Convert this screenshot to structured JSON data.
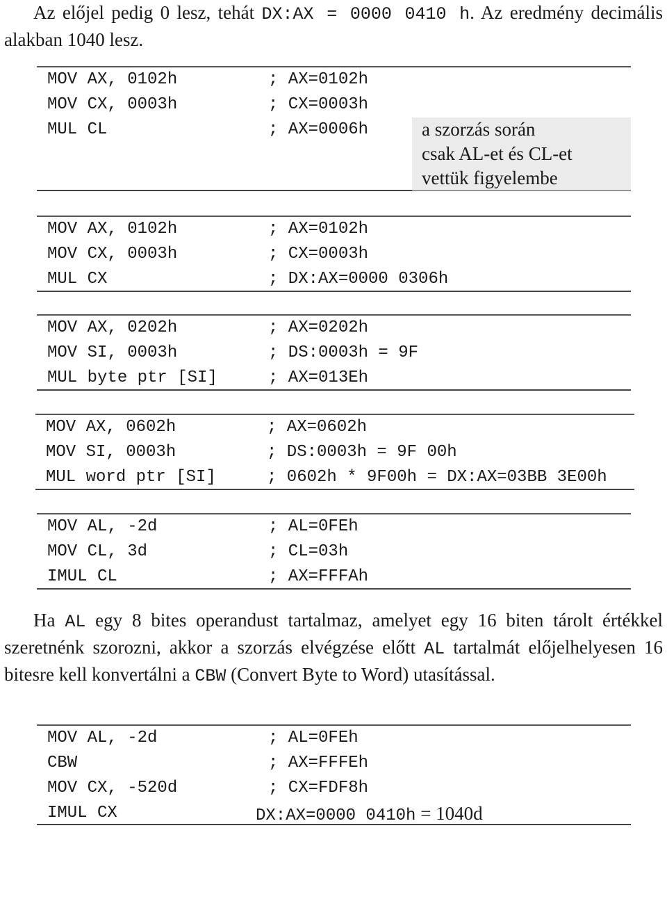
{
  "intro": {
    "text_before": "Az előjel pedig 0 lesz, tehát ",
    "code": "DX:AX = 0000 0410 h",
    "text_after": ".  Az eredmény decimális alakban 1040 lesz."
  },
  "blocks": [
    {
      "rows": [
        {
          "instr": "MOV AX, 0102h",
          "comment": "; AX=0102h"
        },
        {
          "instr": "MOV CX, 0003h",
          "comment": "; CX=0003h"
        },
        {
          "instr": "MUL CL",
          "comment": "; AX=0006h"
        }
      ],
      "note": [
        "a szorzás során",
        "csak AL-et és CL-et",
        "vettük figyelembe"
      ]
    },
    {
      "rows": [
        {
          "instr": "MOV AX, 0102h",
          "comment": "; AX=0102h"
        },
        {
          "instr": "MOV CX, 0003h",
          "comment": "; CX=0003h"
        },
        {
          "instr": "MUL CX",
          "comment": "; DX:AX=0000 0306h"
        }
      ]
    },
    {
      "rows": [
        {
          "instr": "MOV AX, 0202h",
          "comment": "; AX=0202h"
        },
        {
          "instr": "MOV SI, 0003h",
          "comment": "; DS:0003h = 9F"
        },
        {
          "instr": "MUL byte ptr [SI]",
          "comment": "; AX=013Eh"
        }
      ]
    },
    {
      "rows": [
        {
          "instr": "MOV AX, 0602h",
          "comment": "; AX=0602h"
        },
        {
          "instr": "MOV SI, 0003h",
          "comment": "; DS:0003h = 9F 00h"
        },
        {
          "instr": "MUL word ptr [SI]",
          "comment": "; 0602h * 9F00h = DX:AX=03BB 3E00h"
        }
      ]
    },
    {
      "rows": [
        {
          "instr": "MOV AL, -2d",
          "comment": "; AL=0FEh"
        },
        {
          "instr": "MOV CL, 3d",
          "comment": "; CL=03h"
        },
        {
          "instr": "IMUL CL",
          "comment": "; AX=FFFAh"
        }
      ]
    },
    {
      "rows": [
        {
          "instr": "MOV AL, -2d",
          "comment": "; AL=0FEh"
        },
        {
          "instr": "CBW",
          "comment": "; AX=FFFEh"
        },
        {
          "instr": "MOV CX, -520d",
          "comment": "; CX=FDF8h"
        },
        {
          "instr": "IMUL CX",
          "comment": "DX:AX=0000 0410h",
          "comment_tail": " = 1040d"
        }
      ]
    }
  ],
  "paragraph": {
    "p1": "Ha ",
    "c1": "AL",
    "p2": " egy 8 bites operandust tartalmaz, amelyet egy 16 biten tárolt értékkel szeretnénk szorozni, akkor a szorzás elvégzése előtt ",
    "c2": "AL",
    "p3": " tartalmát előjelhelyesen 16 bitesre kell konvertálni a ",
    "c3": "CBW",
    "p4": " (Convert Byte to Word) utasítással."
  }
}
